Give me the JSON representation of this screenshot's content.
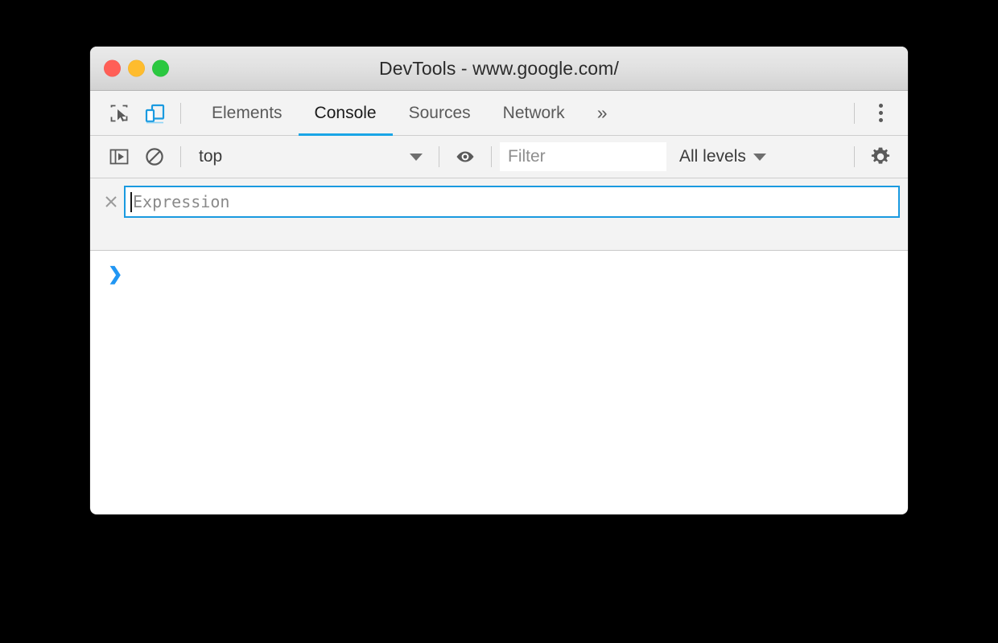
{
  "window": {
    "title": "DevTools - www.google.com/",
    "traffic_lights": [
      {
        "name": "close",
        "color": "#ff5f57"
      },
      {
        "name": "minimize",
        "color": "#febc2e"
      },
      {
        "name": "maximize",
        "color": "#2bc840"
      }
    ]
  },
  "toolbar": {
    "inspect_icon": "inspect-element-icon",
    "device_toggle_icon": "device-toolbar-icon",
    "device_toggle_active_color": "#1a9ae0",
    "overflow_label": "»",
    "more_options_icon": "kebab-menu-icon",
    "tabs": [
      {
        "label": "Elements",
        "active": false
      },
      {
        "label": "Console",
        "active": true
      },
      {
        "label": "Sources",
        "active": false
      },
      {
        "label": "Network",
        "active": false
      }
    ],
    "active_tab_underline_color": "#19a5e6"
  },
  "console_toolbar": {
    "sidebar_icon": "show-console-sidebar-icon",
    "clear_icon": "clear-console-icon",
    "context_selected": "top",
    "context_caret": "▼",
    "eye_icon": "create-live-expression-icon",
    "filter_value": "",
    "filter_placeholder": "Filter",
    "levels_label": "All levels",
    "levels_caret": "▼",
    "settings_icon": "settings-gear-icon"
  },
  "live_expression": {
    "close_icon": "close-live-expression-icon",
    "editor_value": "",
    "editor_placeholder": "Expression",
    "border_color": "#1a9ae0"
  },
  "console": {
    "prompt_symbol": "❯",
    "prompt_color": "#2196f3",
    "prompt_value": ""
  }
}
